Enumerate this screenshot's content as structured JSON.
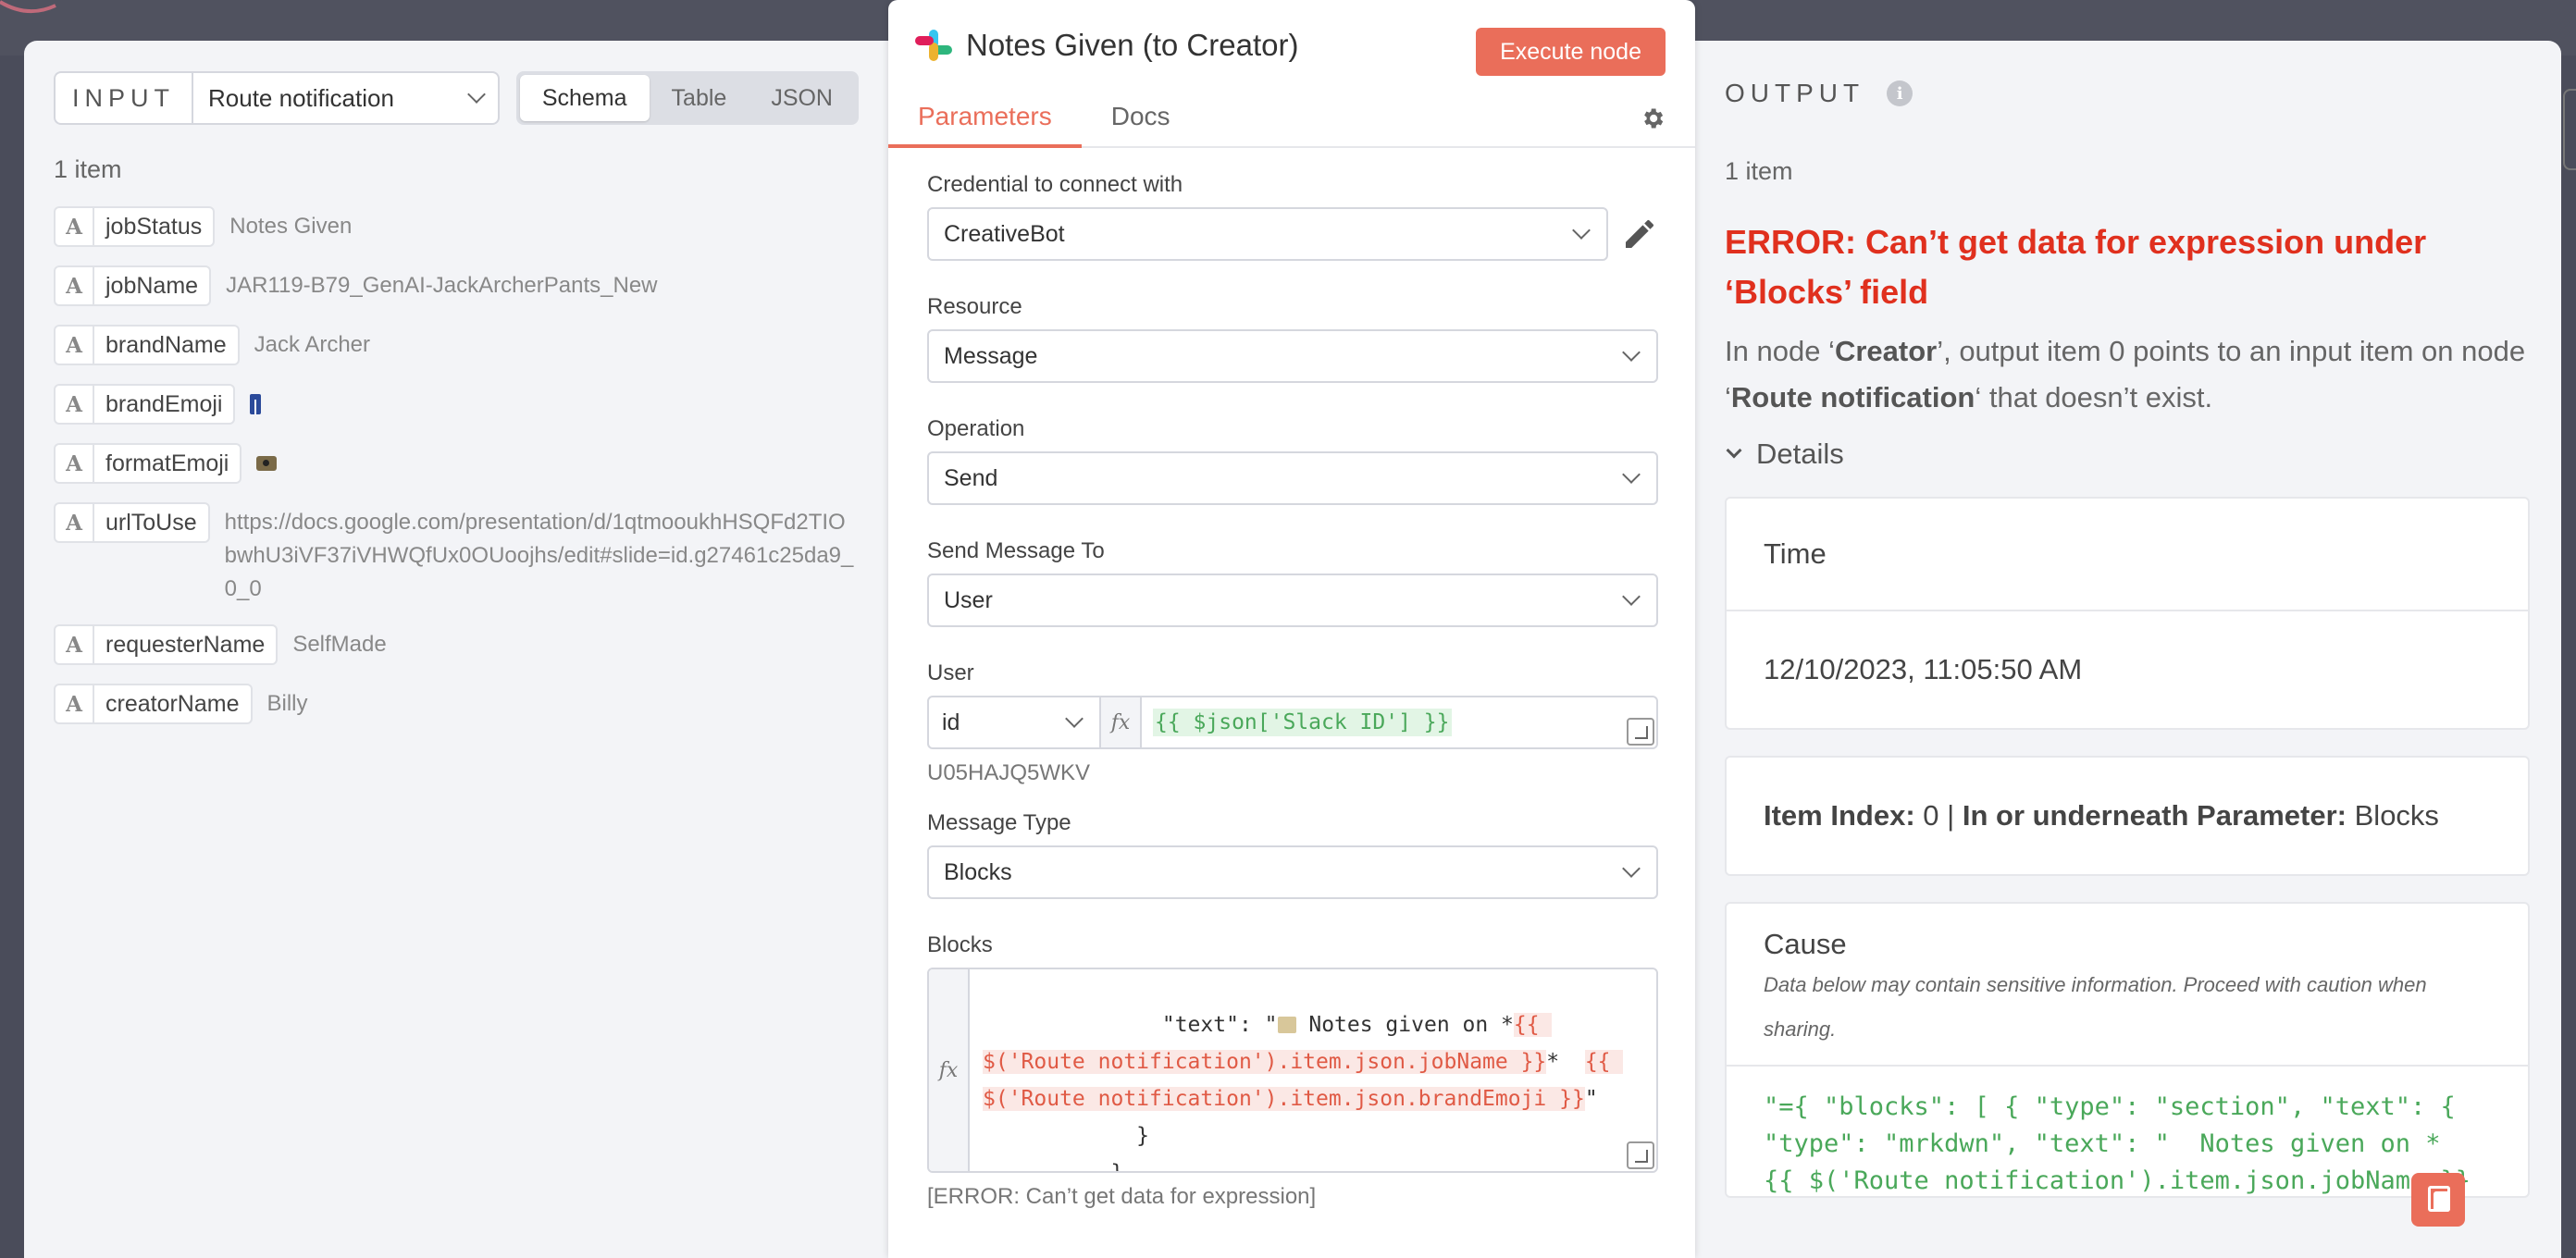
{
  "input": {
    "label": "INPUT",
    "selected_node": "Route notification",
    "views": [
      "Schema",
      "Table",
      "JSON"
    ],
    "item_count": "1 item",
    "fields": [
      {
        "type": "A",
        "key": "jobStatus",
        "value": "Notes Given"
      },
      {
        "type": "A",
        "key": "jobName",
        "value": "JAR119-B79_GenAI-JackArcherPants_New"
      },
      {
        "type": "A",
        "key": "brandName",
        "value": "Jack Archer"
      },
      {
        "type": "A",
        "key": "brandEmoji",
        "value": "jeans-emoji"
      },
      {
        "type": "A",
        "key": "formatEmoji",
        "value": "camera-emoji"
      },
      {
        "type": "A",
        "key": "urlToUse",
        "value": "https://docs.google.com/presentation/d/1qtmooukhHSQFd2TIObwhU3iVF37iVHWQfUx0OUoojhs/edit#slide=id.g27461c25da9_0_0"
      },
      {
        "type": "A",
        "key": "requesterName",
        "value": "SelfMade"
      },
      {
        "type": "A",
        "key": "creatorName",
        "value": "Billy"
      }
    ]
  },
  "node": {
    "title": "Notes Given (to Creator)",
    "execute_label": "Execute node",
    "tabs": [
      "Parameters",
      "Docs"
    ],
    "credential_label": "Credential to connect with",
    "credential_value": "CreativeBot",
    "resource_label": "Resource",
    "resource_value": "Message",
    "operation_label": "Operation",
    "operation_value": "Send",
    "send_to_label": "Send Message To",
    "send_to_value": "User",
    "user_label": "User",
    "user_mode": "id",
    "user_expression": "{{ $json['Slack ID'] }}",
    "user_hint": "U05HAJQ5WKV",
    "message_type_label": "Message Type",
    "message_type_value": "Blocks",
    "blocks_label": "Blocks",
    "blocks_code": {
      "l1_prefix": "              \"text\": \"",
      "l1_text": " Notes given on *",
      "l1_red": "{{ ",
      "l2_red": "$('Route notification').item.json.jobName }}",
      "l2_mid": "*  ",
      "l2_red2": "{{ ",
      "l3_red": "$('Route notification').item.json.brandEmoji }}",
      "l3_end": "\"",
      "l4": "            }",
      "l5": "          }"
    },
    "blocks_error": "[ERROR: Can’t get data for expression]"
  },
  "output": {
    "label": "OUTPUT",
    "item_count": "1 item",
    "error_title": "ERROR: Can’t get data for expression under ‘Blocks’ field",
    "desc_1": "In node ‘",
    "desc_node": "Creator",
    "desc_2": "’, output item 0 points to an input item on node ‘",
    "desc_node2": "Route notification",
    "desc_3": "‘ that doesn’t exist.",
    "details_label": "Details",
    "time_label": "Time",
    "time_value": "12/10/2023, 11:05:50 AM",
    "item_index_label": "Item Index:",
    "item_index_value": "0",
    "sep": "|",
    "param_label": "In or underneath Parameter:",
    "param_value": "Blocks",
    "cause_label": "Cause",
    "cause_note": "Data below may contain sensitive information. Proceed with caution when sharing.",
    "cause_code_l1": "\"={ \"blocks\": [ { \"type\": \"section\", \"text\": {",
    "cause_code_l2": "\"type\": \"mrkdwn\", \"text\": \"  Notes given on *",
    "cause_code_l3": "{{ $('Route notification').item.json.jobName }}"
  },
  "colors": {
    "accent": "#ea6e5a",
    "error": "#e0301e",
    "expression_green": "#4aa85a"
  }
}
